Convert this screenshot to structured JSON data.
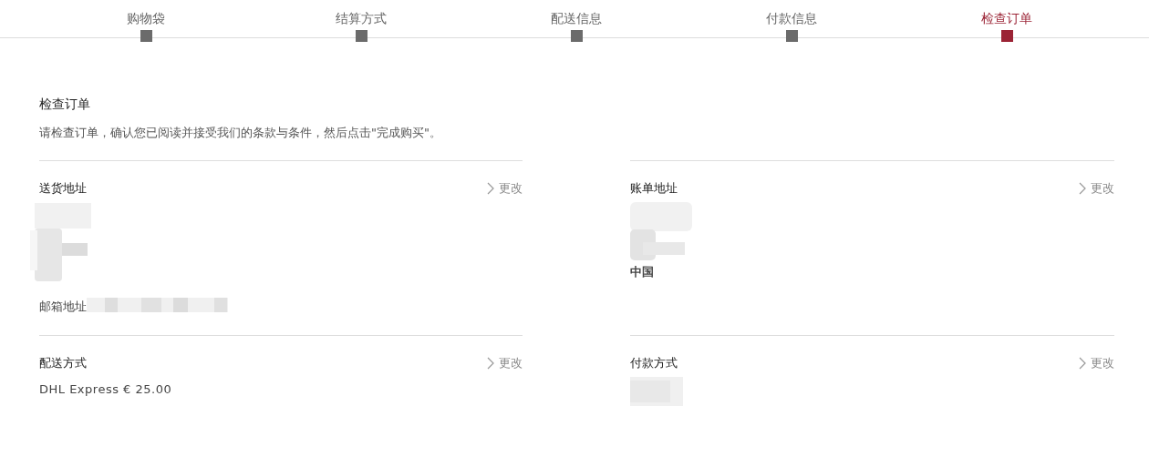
{
  "steps": [
    {
      "label": "购物袋",
      "selected": false
    },
    {
      "label": "结算方式",
      "selected": false
    },
    {
      "label": "配送信息",
      "selected": false
    },
    {
      "label": "付款信息",
      "selected": false
    },
    {
      "label": "检查订单",
      "selected": true
    }
  ],
  "heading": "检查订单",
  "intro": "请检查订单，确认您已阅读并接受我们的条款与条件，然后点击\"完成购买\"。",
  "sections": [
    {
      "title": "送货地址",
      "action": "更改",
      "lines": [
        {
          "kind": "blurblock"
        },
        {
          "kind": "labeled",
          "label": "邮箱地址"
        }
      ]
    },
    {
      "title": "账单地址",
      "action": "更改",
      "lines": [
        {
          "kind": "blursmall"
        },
        {
          "kind": "text",
          "text": "中国"
        }
      ]
    },
    {
      "title": "配送方式",
      "action": "更改",
      "lines": [
        {
          "kind": "text",
          "text": "DHL Express € 25.00"
        }
      ]
    },
    {
      "title": "付款方式",
      "action": "更改",
      "lines": [
        {
          "kind": "blurchip"
        }
      ]
    }
  ]
}
